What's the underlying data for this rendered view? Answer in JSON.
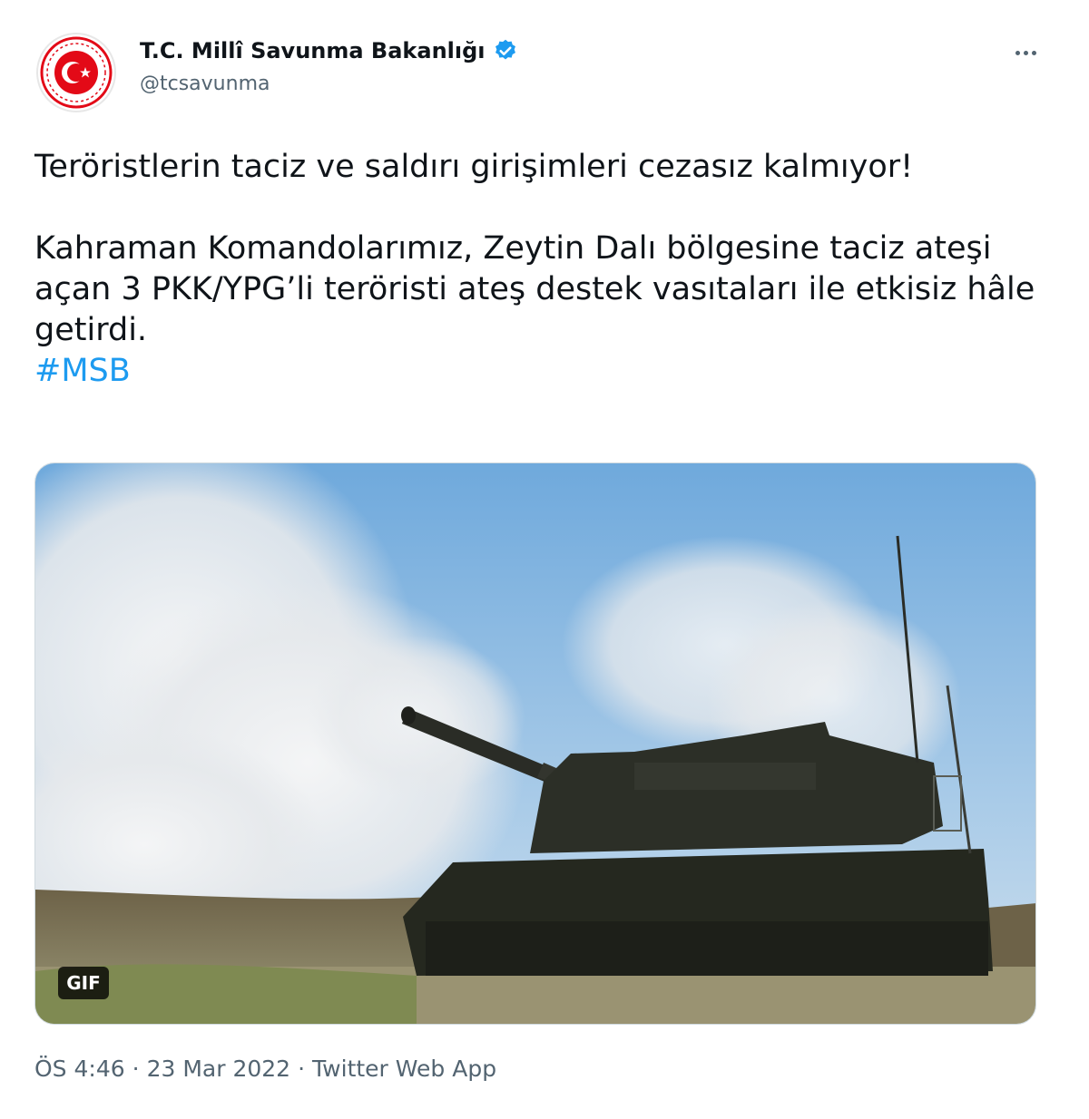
{
  "author": {
    "display_name": "T.C. Millî Savunma Bakanlığı",
    "handle": "@tcsavunma",
    "verified": true,
    "avatar_icon": "turkish-armed-forces-emblem"
  },
  "tweet": {
    "line1": "Teröristlerin taciz ve saldırı girişimleri cezasız kalmıyor!",
    "paragraph2": "Kahraman Komandolarımız, Zeytin Dalı bölgesine taciz ateşi açan 3 PKK/YPG’li teröristi ateş destek vasıtaları ile etkisiz hâle getirdi.",
    "hashtag": "#MSB"
  },
  "media": {
    "badge": "GIF",
    "description_icon": "self-propelled-howitzer-firing"
  },
  "meta": {
    "time": "ÖS 4:46",
    "date": "23 Mar 2022",
    "source": "Twitter Web App"
  },
  "colors": {
    "hashtag": "#1d9bf0",
    "verified": "#1d9bf0",
    "emblem_red": "#e30a17"
  }
}
